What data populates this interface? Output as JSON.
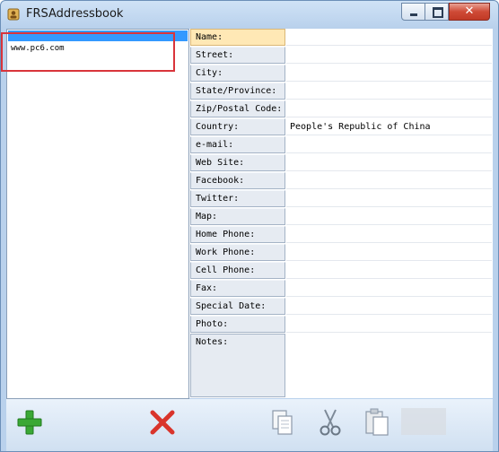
{
  "window": {
    "title": "FRSAddressbook",
    "close_glyph": "✕"
  },
  "list": {
    "items": [
      "www.pc6.com"
    ]
  },
  "fields": [
    {
      "label": "Name:",
      "value": ""
    },
    {
      "label": "Street:",
      "value": ""
    },
    {
      "label": "City:",
      "value": ""
    },
    {
      "label": "State/Province:",
      "value": ""
    },
    {
      "label": "Zip/Postal Code:",
      "value": ""
    },
    {
      "label": "Country:",
      "value": "People's Republic of China"
    },
    {
      "label": "e-mail:",
      "value": ""
    },
    {
      "label": "Web Site:",
      "value": ""
    },
    {
      "label": "Facebook:",
      "value": ""
    },
    {
      "label": "Twitter:",
      "value": ""
    },
    {
      "label": "Map:",
      "value": ""
    },
    {
      "label": "Home Phone:",
      "value": ""
    },
    {
      "label": "Work Phone:",
      "value": ""
    },
    {
      "label": "Cell Phone:",
      "value": ""
    },
    {
      "label": "Fax:",
      "value": ""
    },
    {
      "label": "Special Date:",
      "value": ""
    },
    {
      "label": "Photo:",
      "value": ""
    }
  ],
  "notes": {
    "label": "Notes:",
    "value": ""
  },
  "toolbar": {
    "icons": [
      "add-icon",
      "delete-icon",
      "copy-icon",
      "cut-icon",
      "paste-icon"
    ]
  },
  "colors": {
    "add": "#3aa835",
    "delete": "#d9342b",
    "selection": "#3399ff",
    "highlight": "#d9343b"
  }
}
